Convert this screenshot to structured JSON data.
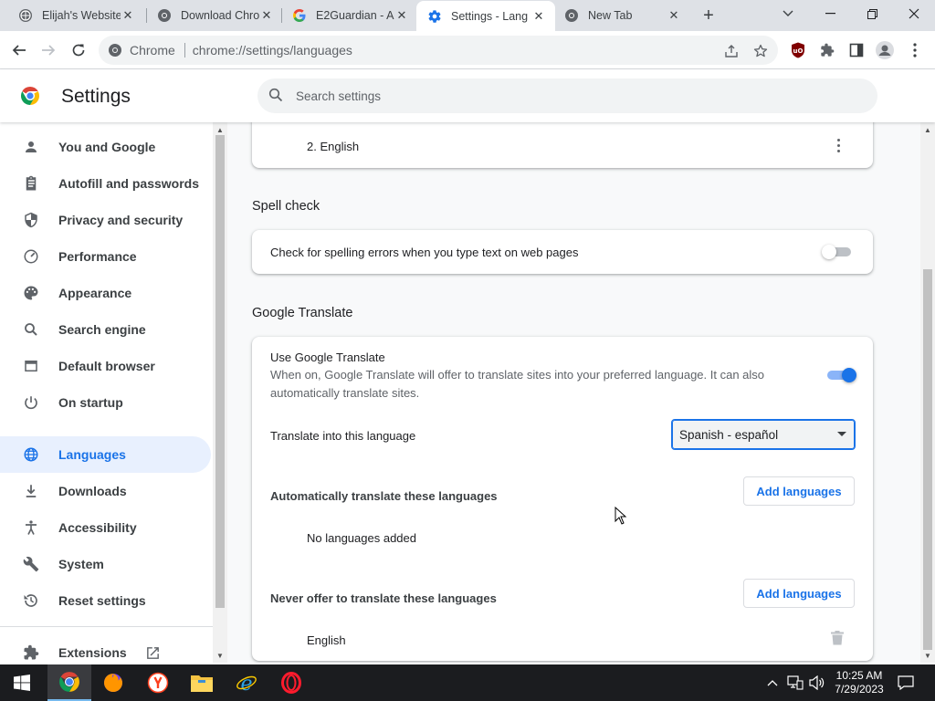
{
  "tabs": [
    {
      "title": "Elijah's Website",
      "icon": "site-favicon"
    },
    {
      "title": "Download Chro",
      "icon": "chrome-favicon"
    },
    {
      "title": "E2Guardian - Ac",
      "icon": "google-favicon"
    },
    {
      "title": "Settings - Lang",
      "icon": "settings-favicon",
      "active": true
    },
    {
      "title": "New Tab",
      "icon": "chrome-favicon"
    }
  ],
  "toolbar": {
    "chip_label": "Chrome",
    "url": "chrome://settings/languages"
  },
  "header": {
    "title": "Settings",
    "search_placeholder": "Search settings"
  },
  "sidebar": {
    "items": [
      {
        "label": "You and Google",
        "icon": "person-icon"
      },
      {
        "label": "Autofill and passwords",
        "icon": "clipboard-icon"
      },
      {
        "label": "Privacy and security",
        "icon": "shield-icon"
      },
      {
        "label": "Performance",
        "icon": "gauge-icon"
      },
      {
        "label": "Appearance",
        "icon": "palette-icon"
      },
      {
        "label": "Search engine",
        "icon": "magnifier-icon"
      },
      {
        "label": "Default browser",
        "icon": "browser-window-icon"
      },
      {
        "label": "On startup",
        "icon": "power-icon"
      },
      {
        "label": "Languages",
        "icon": "globe-icon",
        "selected": true
      },
      {
        "label": "Downloads",
        "icon": "download-icon"
      },
      {
        "label": "Accessibility",
        "icon": "accessibility-icon"
      },
      {
        "label": "System",
        "icon": "wrench-icon"
      },
      {
        "label": "Reset settings",
        "icon": "history-icon"
      }
    ],
    "extensions_label": "Extensions"
  },
  "main": {
    "preferred_language_item": "2. English",
    "spell_check": {
      "title": "Spell check",
      "label": "Check for spelling errors when you type text on web pages",
      "enabled": false
    },
    "google_translate": {
      "title": "Google Translate",
      "use_label": "Use Google Translate",
      "use_description_line1": "When on, Google Translate will offer to translate sites into your preferred language. It can also",
      "use_description_line2": "automatically translate sites.",
      "enabled": true,
      "target_label": "Translate into this language",
      "target_value": "Spanish - español",
      "auto_label": "Automatically translate these languages",
      "auto_button": "Add languages",
      "auto_empty": "No languages added",
      "never_label": "Never offer to translate these languages",
      "never_button": "Add languages",
      "never_items": [
        "English"
      ]
    }
  },
  "taskbar": {
    "time": "10:25 AM",
    "date": "7/29/2023"
  },
  "colors": {
    "accent": "#1a73e8",
    "selected_bg": "#e8f0fe",
    "tabstrip": "#dee1e6",
    "taskbar": "#1b1c1f"
  }
}
